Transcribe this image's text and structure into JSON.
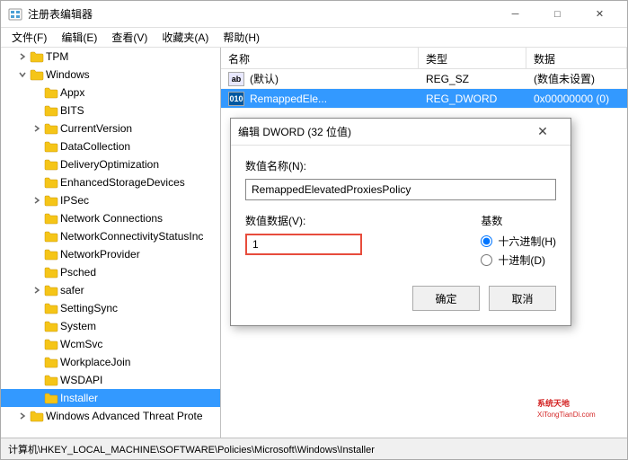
{
  "window": {
    "title": "注册表编辑器",
    "close_btn": "✕",
    "minimize_btn": "─",
    "maximize_btn": "□"
  },
  "menu": {
    "items": [
      "文件(F)",
      "编辑(E)",
      "查看(V)",
      "收藏夹(A)",
      "帮助(H)"
    ]
  },
  "tree": {
    "items": [
      {
        "id": "tpm",
        "label": "TPM",
        "indent": 1,
        "expanded": false,
        "selected": false
      },
      {
        "id": "windows",
        "label": "Windows",
        "indent": 1,
        "expanded": true,
        "selected": false
      },
      {
        "id": "appx",
        "label": "Appx",
        "indent": 2,
        "expanded": false,
        "selected": false
      },
      {
        "id": "bits",
        "label": "BITS",
        "indent": 2,
        "expanded": false,
        "selected": false
      },
      {
        "id": "currentversion",
        "label": "CurrentVersion",
        "indent": 2,
        "expanded": false,
        "selected": false
      },
      {
        "id": "datacollection",
        "label": "DataCollection",
        "indent": 2,
        "expanded": false,
        "selected": false
      },
      {
        "id": "deliveryoptimization",
        "label": "DeliveryOptimization",
        "indent": 2,
        "expanded": false,
        "selected": false
      },
      {
        "id": "enhancedstoragedevices",
        "label": "EnhancedStorageDevices",
        "indent": 2,
        "expanded": false,
        "selected": false
      },
      {
        "id": "ipsec",
        "label": "IPSec",
        "indent": 2,
        "expanded": false,
        "selected": false
      },
      {
        "id": "networkconnections",
        "label": "Network Connections",
        "indent": 2,
        "expanded": false,
        "selected": false
      },
      {
        "id": "networkconnectivitystatusinc",
        "label": "NetworkConnectivityStatusInc",
        "indent": 2,
        "expanded": false,
        "selected": false
      },
      {
        "id": "networkprovider",
        "label": "NetworkProvider",
        "indent": 2,
        "expanded": false,
        "selected": false
      },
      {
        "id": "psched",
        "label": "Psched",
        "indent": 2,
        "expanded": false,
        "selected": false
      },
      {
        "id": "safer",
        "label": "safer",
        "indent": 2,
        "expanded": false,
        "selected": false
      },
      {
        "id": "settingsync",
        "label": "SettingSync",
        "indent": 2,
        "expanded": false,
        "selected": false
      },
      {
        "id": "system",
        "label": "System",
        "indent": 2,
        "expanded": false,
        "selected": false
      },
      {
        "id": "wcmsvc",
        "label": "WcmSvc",
        "indent": 2,
        "expanded": false,
        "selected": false
      },
      {
        "id": "workplacejoin",
        "label": "WorkplaceJoin",
        "indent": 2,
        "expanded": false,
        "selected": false
      },
      {
        "id": "wsdapi",
        "label": "WSDAPI",
        "indent": 2,
        "expanded": false,
        "selected": false
      },
      {
        "id": "installer",
        "label": "Installer",
        "indent": 2,
        "expanded": false,
        "selected": true
      },
      {
        "id": "windowsadvancedthreatprote",
        "label": "Windows Advanced Threat Prote",
        "indent": 1,
        "expanded": false,
        "selected": false
      }
    ]
  },
  "table": {
    "headers": [
      "名称",
      "类型",
      "数据"
    ],
    "rows": [
      {
        "name": "(默认)",
        "type": "REG_SZ",
        "data": "(数值未设置)",
        "icon": "ab",
        "selected": false
      },
      {
        "name": "RemappedEle...",
        "type": "REG_DWORD",
        "data": "0x00000000 (0)",
        "icon": "010",
        "selected": true
      }
    ]
  },
  "dialog": {
    "title": "编辑 DWORD (32 位值)",
    "close_btn": "✕",
    "value_name_label": "数值名称(N):",
    "value_name": "RemappedElevatedProxiesPolicy",
    "value_data_label": "数值数据(V):",
    "value_data": "1",
    "base_label": "基数",
    "base_options": [
      {
        "label": "十六进制(H)",
        "value": "hex",
        "checked": true
      },
      {
        "label": "十进制(D)",
        "value": "dec",
        "checked": false
      }
    ],
    "ok_label": "确定",
    "cancel_label": "取消"
  },
  "statusbar": {
    "text": "计算机\\HKEY_LOCAL_MACHINE\\SOFTWARE\\Policies\\Microsoft\\Windows\\Installer"
  },
  "watermark": {
    "site": "XiTongTianDi.com"
  },
  "colors": {
    "selected_row": "#0078d7",
    "border_red": "#e74c3c",
    "folder_yellow": "#f5c518"
  }
}
